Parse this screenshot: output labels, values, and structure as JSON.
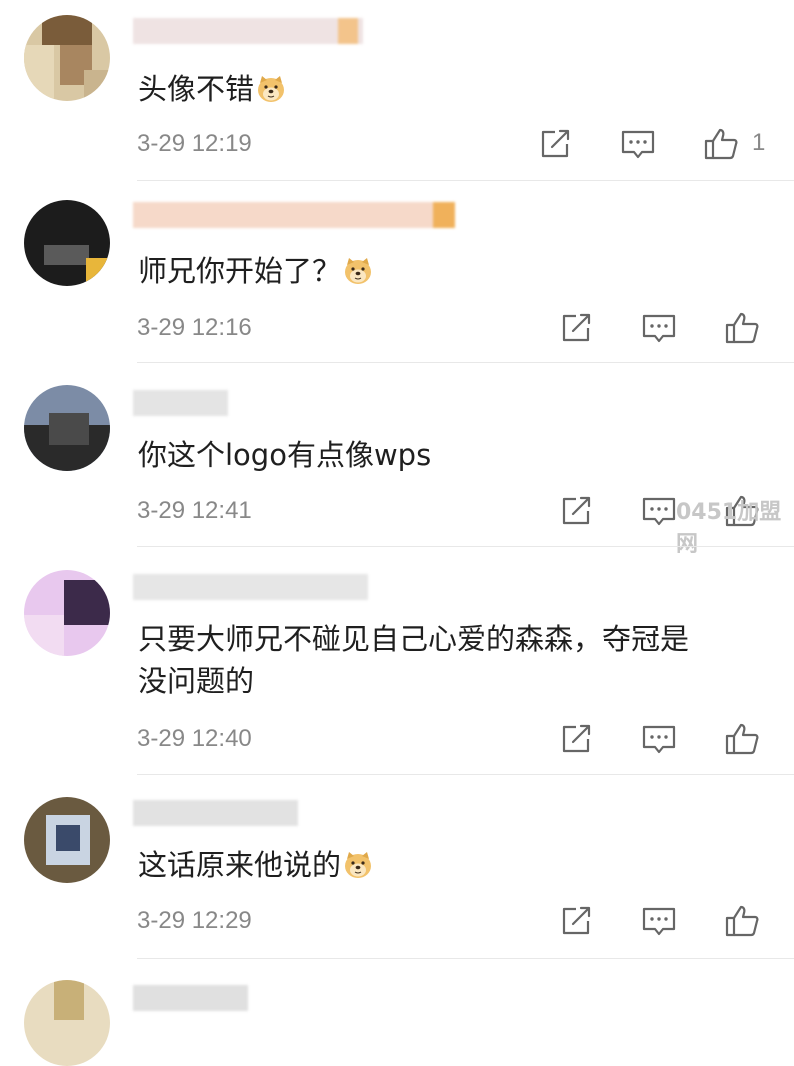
{
  "comments": [
    {
      "text": "头像不错",
      "emoji": "doge",
      "time": "3-29 12:19",
      "likes": "1"
    },
    {
      "text": "师兄你开始了？",
      "emoji": "doge",
      "time": "3-29 12:16",
      "likes": ""
    },
    {
      "text": "你这个logo有点像wps",
      "emoji": "",
      "time": "3-29 12:41",
      "likes": ""
    },
    {
      "text": "只要大师兄不碰见自己心爱的森森，夺冠是\n没问题的",
      "emoji": "",
      "time": "3-29 12:40",
      "likes": ""
    },
    {
      "text": "这话原来他说的",
      "emoji": "doge",
      "time": "3-29 12:29",
      "likes": ""
    }
  ],
  "watermark": "0451加盟网",
  "icons": {
    "share": "share-icon",
    "reply": "comment-icon",
    "like": "thumbs-up-icon"
  },
  "colors": {
    "text": "#1f1f1f",
    "meta": "#888888",
    "divider": "#e8e8e8"
  }
}
